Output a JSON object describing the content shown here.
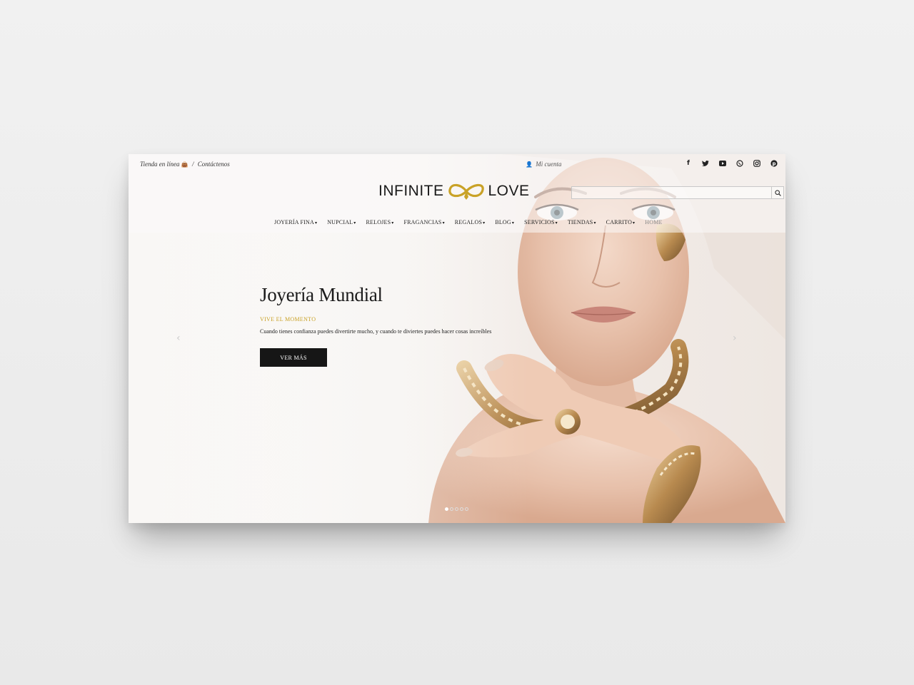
{
  "topbar": {
    "shop_label": "Tienda en línea",
    "bag_icon": "shopping-bag-icon",
    "separator": "/",
    "contact_label": "Contáctenos",
    "account_label": "Mi cuenta",
    "account_icon": "user-icon"
  },
  "social": [
    {
      "icon": "facebook-icon",
      "glyph": "f"
    },
    {
      "icon": "twitter-icon",
      "glyph": "🐦"
    },
    {
      "icon": "youtube-icon",
      "glyph": "▶"
    },
    {
      "icon": "whatsapp-icon",
      "glyph": "✆"
    },
    {
      "icon": "instagram-icon",
      "glyph": "◎"
    },
    {
      "icon": "pinterest-icon",
      "glyph": "P"
    }
  ],
  "logo": {
    "left": "INFINITE",
    "right": "LOVE",
    "accent": "#c9a227"
  },
  "search": {
    "placeholder": "",
    "value": ""
  },
  "nav": [
    {
      "label": "JOYERÍA FINA",
      "caret": true
    },
    {
      "label": "NUPCIAL",
      "caret": true
    },
    {
      "label": "RELOJES",
      "caret": true
    },
    {
      "label": "FRAGANCIAS",
      "caret": true
    },
    {
      "label": "REGALOS",
      "caret": true
    },
    {
      "label": "BLOG",
      "caret": true
    },
    {
      "label": "SERVICIOS",
      "caret": true
    },
    {
      "label": "TIENDAS",
      "caret": true
    },
    {
      "label": "CARRITO",
      "caret": true
    },
    {
      "label": "HOME",
      "caret": false
    }
  ],
  "hero": {
    "title": "Joyería Mundial",
    "subtitle": "VIVE EL MOMENTO",
    "description": "Cuando tienes confianza puedes divertirte mucho, y cuando te diviertes puedes hacer cosas increíbles",
    "cta_label": "VER MÁS",
    "prev_glyph": "‹",
    "next_glyph": "›",
    "slides_total": 5,
    "slide_active": 1
  },
  "colors": {
    "gold": "#c9a227",
    "dark": "#161616"
  }
}
